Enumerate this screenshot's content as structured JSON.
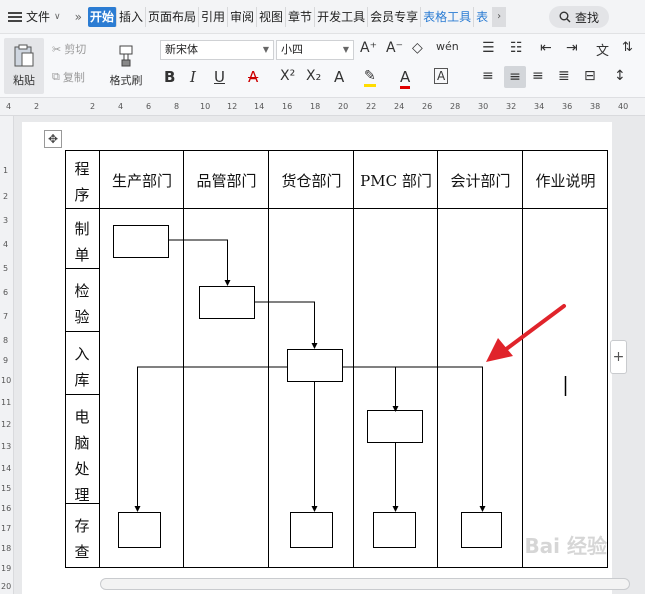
{
  "menubar": {
    "file_label": "文件",
    "tabs": [
      "开始",
      "插入",
      "页面布局",
      "引用",
      "审阅",
      "视图",
      "章节",
      "开发工具",
      "会员专享",
      "表格工具",
      "表"
    ],
    "search_label": "查找"
  },
  "ribbon": {
    "paste": "粘贴",
    "cut": "剪切",
    "copy": "复制",
    "format_painter": "格式刷",
    "font_name": "新宋体",
    "font_size": "小四"
  },
  "ruler_h": [
    "4",
    "2",
    "2",
    "4",
    "6",
    "8",
    "10",
    "12",
    "14",
    "16",
    "18",
    "20",
    "22",
    "24",
    "26",
    "28",
    "30",
    "32",
    "34",
    "36",
    "38",
    "40"
  ],
  "ruler_v": [
    "1",
    "2",
    "3",
    "4",
    "5",
    "6",
    "7",
    "8",
    "9",
    "10",
    "11",
    "12",
    "13",
    "14",
    "15",
    "16",
    "17",
    "18",
    "19",
    "20"
  ],
  "table": {
    "header": [
      "程序",
      "生产部门",
      "品管部门",
      "货仓部门",
      "PMC 部门",
      "会计部门",
      "作业说明"
    ],
    "rows": [
      "制单",
      "检验",
      "入库",
      "电脑处理",
      "存查"
    ]
  },
  "colors": {
    "accent": "#2b7cd3",
    "arrow": "#e0242b"
  },
  "watermark": "Bai 经验"
}
